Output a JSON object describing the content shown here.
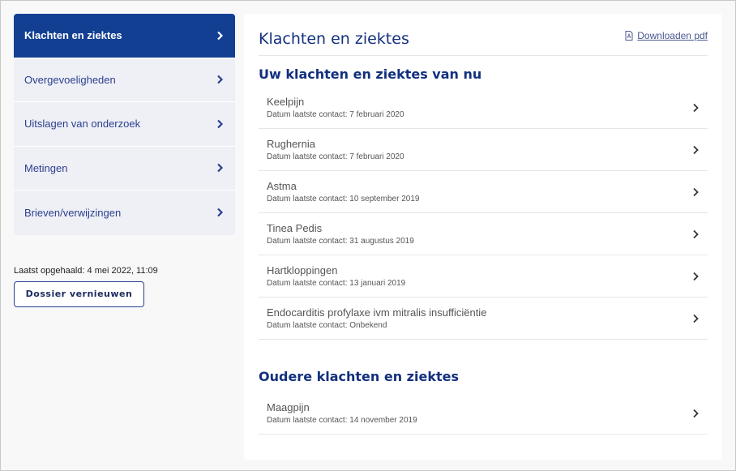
{
  "sidebar": {
    "items": [
      {
        "label": "Klachten en ziektes",
        "active": true
      },
      {
        "label": "Overgevoeligheden"
      },
      {
        "label": "Uitslagen van onderzoek"
      },
      {
        "label": "Metingen"
      },
      {
        "label": "Brieven/verwijzingen"
      }
    ],
    "fetched": "Laatst opgehaald: 4 mei 2022, 11:09",
    "refresh_label": "Dossier vernieuwen"
  },
  "main": {
    "title": "Klachten en ziektes",
    "download_label": "Downloaden pdf",
    "current_heading": "Uw klachten en ziektes van nu",
    "current": [
      {
        "title": "Keelpijn",
        "sub": "Datum laatste contact: 7 februari 2020"
      },
      {
        "title": "Rughernia",
        "sub": "Datum laatste contact: 7 februari 2020"
      },
      {
        "title": "Astma",
        "sub": "Datum laatste contact: 10 september 2019"
      },
      {
        "title": "Tinea Pedis",
        "sub": "Datum laatste contact: 31 augustus 2019"
      },
      {
        "title": "Hartkloppingen",
        "sub": "Datum laatste contact: 13 januari 2019"
      },
      {
        "title": "Endocarditis profylaxe ivm mitralis insufficiëntie",
        "sub": "Datum laatste contact: Onbekend"
      }
    ],
    "older_heading": "Oudere klachten en ziektes",
    "older": [
      {
        "title": "Maagpijn",
        "sub": "Datum laatste contact: 14 november 2019"
      }
    ]
  }
}
